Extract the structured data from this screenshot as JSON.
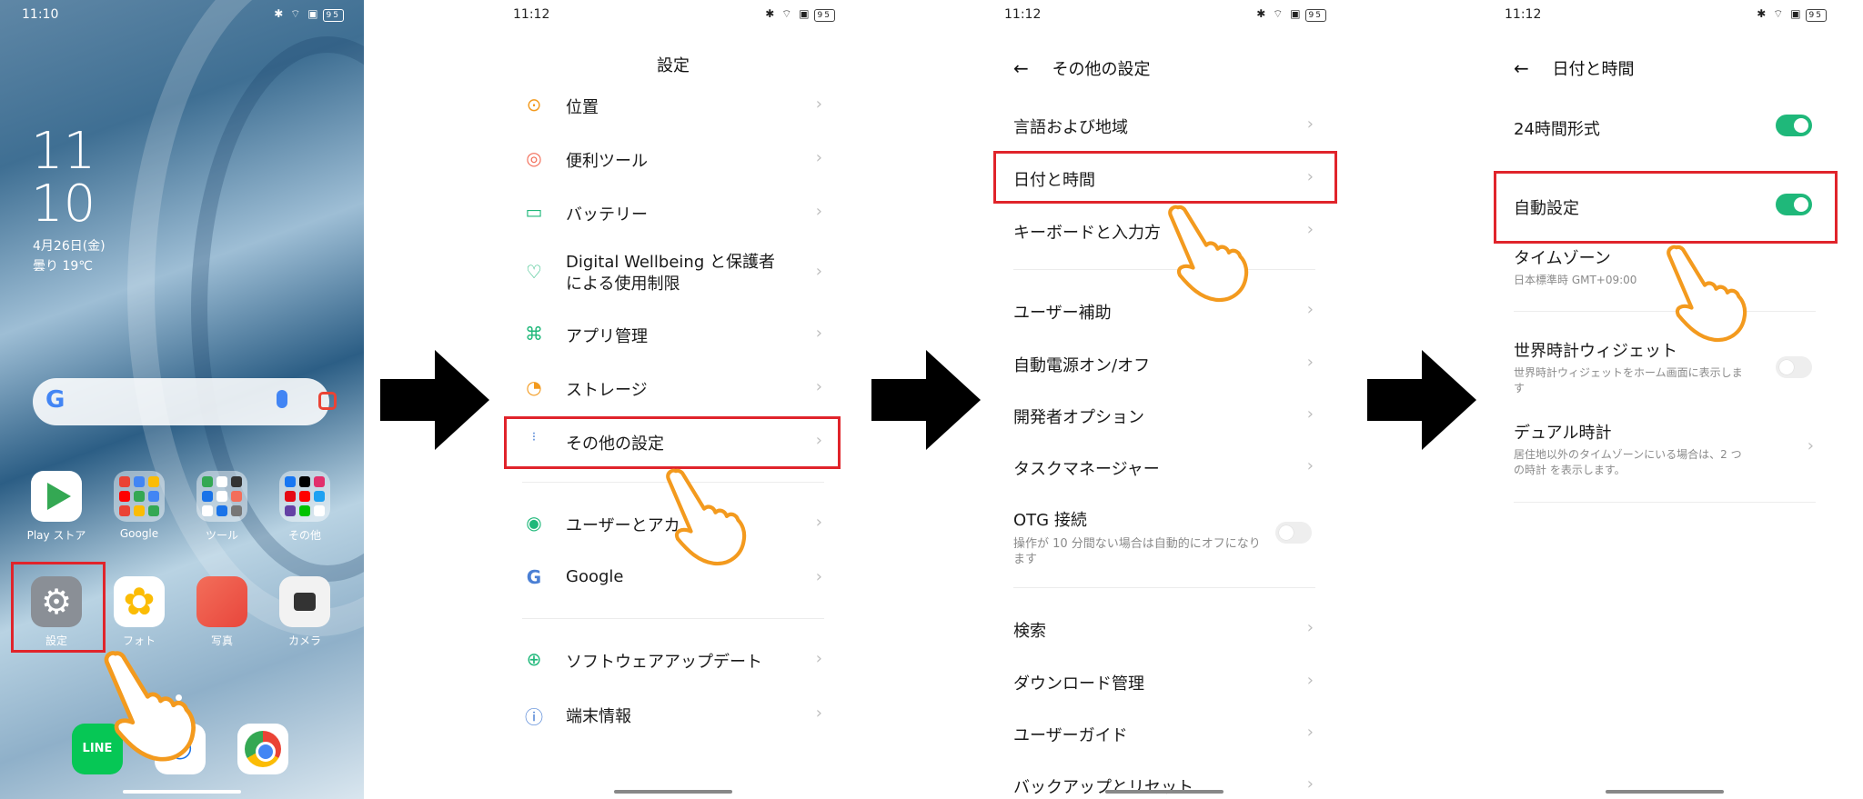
{
  "panel1": {
    "status_time": "11:10",
    "status_battery": "95",
    "clock_hour": "11",
    "clock_minute": "10",
    "date": "4月26日(金)",
    "weather": "曇り 19℃",
    "apps_row1": [
      {
        "label": "Play ストア",
        "icon": "play-store-icon"
      },
      {
        "label": "Google",
        "icon": "google-folder-icon"
      },
      {
        "label": "ツール",
        "icon": "tools-folder-icon"
      },
      {
        "label": "その他",
        "icon": "other-folder-icon"
      }
    ],
    "apps_row2": [
      {
        "label": "設定",
        "icon": "settings-gear-icon"
      },
      {
        "label": "フォト",
        "icon": "photos-icon"
      },
      {
        "label": "写真",
        "icon": "gallery-icon"
      },
      {
        "label": "カメラ",
        "icon": "camera-icon"
      }
    ],
    "dock": [
      {
        "label": "LINE",
        "icon": "line-icon"
      },
      {
        "icon": "phone-icon"
      },
      {
        "icon": "chrome-icon"
      }
    ]
  },
  "panel2": {
    "status_time": "11:12",
    "status_battery": "95",
    "title": "設定",
    "items": [
      {
        "label": "位置",
        "icon": "location-icon"
      },
      {
        "label": "便利ツール",
        "icon": "tools-icon"
      },
      {
        "label": "バッテリー",
        "icon": "battery-icon"
      },
      {
        "label": "Digital Wellbeing と保護者による使用制限",
        "icon": "wellbeing-icon"
      },
      {
        "label": "アプリ管理",
        "icon": "apps-icon"
      },
      {
        "label": "ストレージ",
        "icon": "storage-icon"
      },
      {
        "label": "その他の設定",
        "icon": "more-settings-icon"
      },
      {
        "label": "ユーザーとアカ",
        "icon": "users-icon"
      },
      {
        "label": "Google",
        "icon": "google-icon"
      },
      {
        "label": "ソフトウェアアップデート",
        "icon": "update-icon"
      },
      {
        "label": "端末情報",
        "icon": "info-icon"
      }
    ]
  },
  "panel3": {
    "status_time": "11:12",
    "status_battery": "95",
    "title": "その他の設定",
    "items": [
      {
        "label": "言語および地域"
      },
      {
        "label": "日付と時間"
      },
      {
        "label": "キーボードと入力方"
      },
      {
        "label": "ユーザー補助"
      },
      {
        "label": "自動電源オン/オフ"
      },
      {
        "label": "開発者オプション"
      },
      {
        "label": "タスクマネージャー"
      },
      {
        "label": "OTG 接続",
        "sub": "操作が 10 分間ない場合は自動的にオフになります",
        "toggle": "off"
      },
      {
        "label": "検索"
      },
      {
        "label": "ダウンロード管理"
      },
      {
        "label": "ユーザーガイド"
      },
      {
        "label": "バックアップとリセット"
      }
    ]
  },
  "panel4": {
    "status_time": "11:12",
    "status_battery": "95",
    "title": "日付と時間",
    "items": [
      {
        "label": "24時間形式",
        "toggle": "on"
      },
      {
        "label": "自動設定",
        "toggle": "on"
      },
      {
        "label": "タイムゾーン",
        "sub": "日本標準時 GMT+09:00"
      },
      {
        "label": "世界時計ウィジェット",
        "sub": "世界時計ウィジェットをホーム画面に表示しま す",
        "toggle": "off"
      },
      {
        "label": "デュアル時計",
        "sub": "居住地以外のタイムゾーンにいる場合は、2 つの時計 を表示します。"
      }
    ]
  },
  "colors": {
    "highlight": "#e0242b",
    "toggle_on": "#1fb87a",
    "hand_fill": "#ffffff",
    "hand_stroke": "#f39a1e",
    "arrow": "#000000"
  }
}
